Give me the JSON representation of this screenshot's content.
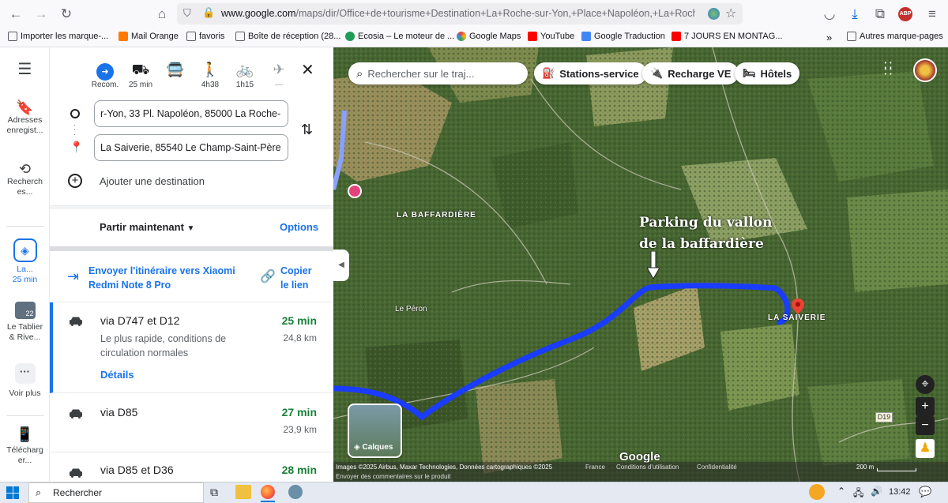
{
  "browser": {
    "url_host": "www.google.com",
    "url_path": "/maps/dir/Office+de+tourisme+Destination+La+Roche-sur-Yon,+Place+Napoléon,+La+Roche-s",
    "bookmarks": [
      {
        "label": "Importer les marque-...",
        "color": "#5b5b66"
      },
      {
        "label": "Mail Orange",
        "color": "#ff7900"
      },
      {
        "label": "favoris",
        "color": "#5b5b66"
      },
      {
        "label": "Boîte de réception (28...",
        "color": "#5b5b66"
      },
      {
        "label": "Ecosia – Le moteur de ...",
        "color": "#1f9d55"
      },
      {
        "label": "Google Maps",
        "color": "#34a853"
      },
      {
        "label": "YouTube",
        "color": "#ff0000"
      },
      {
        "label": "Google Traduction",
        "color": "#4285f4"
      },
      {
        "label": "7 JOURS EN MONTAG...",
        "color": "#ff0000"
      }
    ],
    "other_bookmarks": "Autres marque-pages"
  },
  "rail": {
    "menu_icon": "menu-icon",
    "saved": "Adresses enregist...",
    "recent": "Recherch es...",
    "active_label": "La...",
    "active_time": "25 min",
    "tablier": "Le Tablier & Rive...",
    "tablier_badge": "22",
    "more": "Voir plus",
    "download": "Télécharg er..."
  },
  "panel": {
    "modes": [
      {
        "icon": "directions-icon",
        "glyph": "◆",
        "label": "Recom."
      },
      {
        "icon": "car-icon",
        "glyph": "🚗",
        "label": "25 min"
      },
      {
        "icon": "transit-icon",
        "glyph": "🚌",
        "label": ""
      },
      {
        "icon": "walk-icon",
        "glyph": "🚶",
        "label": "4h38"
      },
      {
        "icon": "bike-icon",
        "glyph": "🚲",
        "label": "1h15"
      },
      {
        "icon": "flight-icon",
        "glyph": "✈",
        "label": "—"
      }
    ],
    "origin": "r-Yon, 33 Pl. Napoléon, 85000 La Roche-",
    "destination": "La Saiverie, 85540 Le Champ-Saint-Père",
    "add_destination": "Ajouter une destination",
    "depart": "Partir maintenant",
    "options": "Options",
    "send_line1": "Envoyer l'itinéraire vers Xiaomi",
    "send_line2": "Redmi Note 8 Pro",
    "copy_line1": "Copier",
    "copy_line2": "le lien",
    "routes": [
      {
        "name": "via D747 et D12",
        "time": "25 min",
        "dist": "24,8 km",
        "desc1": "Le plus rapide, conditions de",
        "desc2": "circulation normales",
        "details": "Détails"
      },
      {
        "name": "via D85",
        "time": "27 min",
        "dist": "23,9 km"
      },
      {
        "name": "via D85 et D36",
        "time": "28 min",
        "dist": ""
      }
    ]
  },
  "map": {
    "search_placeholder": "Rechercher sur le traj...",
    "chips": [
      "Stations-service",
      "Recharge VE",
      "Hôtels"
    ],
    "annotation_line1": "Parking du vallon",
    "annotation_line2": "de la baffardière",
    "place_baffardiere": "LA BAFFARDIÈRE",
    "place_saiverie": "LA SAIVERIE",
    "place_peron": "Le Péron",
    "road_label": "D19",
    "layers": "Calques",
    "google": "Google",
    "attribution": "Images ©2025 Airbus, Maxar Technologies, Données cartographiques ©2025",
    "france": "France",
    "terms": "Conditions d'utilisation",
    "privacy": "Confidentialité",
    "scale": "200 m",
    "feedback": "Envoyer des commentaires sur le produit",
    "route_color": "#1a3cff"
  },
  "taskbar": {
    "search": "Rechercher",
    "time": "13:42"
  }
}
